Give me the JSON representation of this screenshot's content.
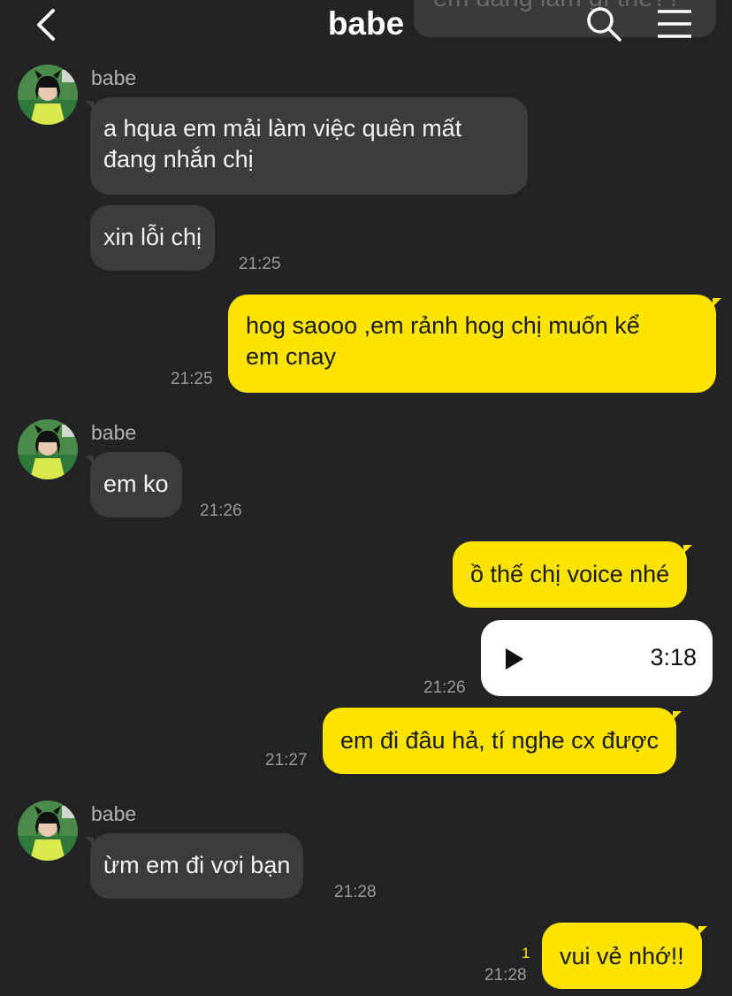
{
  "header": {
    "title": "babe",
    "pinned_preview": "em đang làm gì thế??"
  },
  "messages": [
    {
      "sender": "babe",
      "text": "a hqua em mải làm việc quên mất đang nhắn chị",
      "line1": "a hqua em mải làm việc quên mất",
      "line2": "đang nhắn chị"
    },
    {
      "text": "xin lỗi chị",
      "time": "21:25"
    },
    {
      "text_line1": "hog saooo ,em rảnh hog chị muốn kể",
      "text_line2": "em cnay",
      "time": "21:25"
    },
    {
      "sender": "babe",
      "text": "em ko",
      "time": "21:26"
    },
    {
      "text": "ồ thế chị voice nhé"
    },
    {
      "voice_duration": "3:18",
      "time": "21:26"
    },
    {
      "text": "em đi đâu hả, tí nghe cx được",
      "time": "21:27"
    },
    {
      "sender": "babe",
      "text": "ừm em đi vơi bạn",
      "time": "21:28"
    },
    {
      "text": "vui vẻ nhớ!!",
      "time": "21:28",
      "unread": "1"
    }
  ],
  "colors": {
    "background": "#232325",
    "incoming": "#3c3c3e",
    "outgoing": "#fce300"
  }
}
